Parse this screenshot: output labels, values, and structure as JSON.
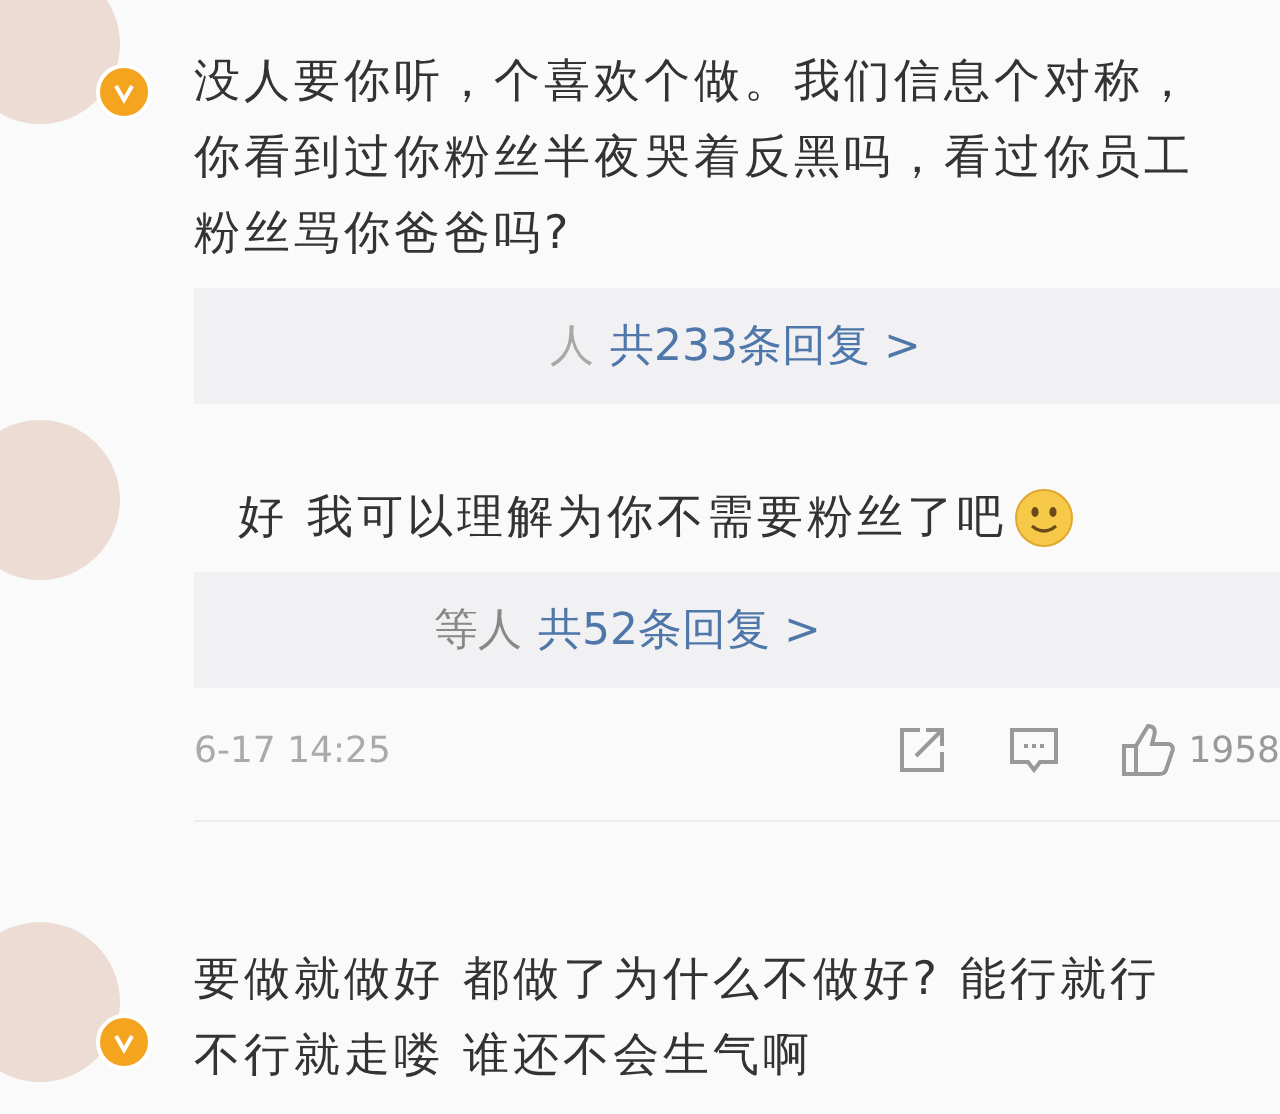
{
  "comments": [
    {
      "lines": [
        "没人要你听，个喜欢个做。我们信息个对称，",
        "你看到过你粉丝半夜哭着反黑吗，看过你员工",
        "粉丝骂你爸爸吗?"
      ],
      "verified": true,
      "replies": {
        "names": "人",
        "count": "共233条回复 >"
      }
    },
    {
      "lines": [
        "好 我可以理解为你不需要粉丝了吧"
      ],
      "emoji": true,
      "verified": false,
      "replies": {
        "names": "等人",
        "count": "共52条回复 >"
      },
      "time": "6-17 14:25",
      "likes": "1958"
    },
    {
      "lines": [
        "要做就做好 都做了为什么不做好? 能行就行",
        "不行就走喽 谁还不会生气啊"
      ],
      "verified": true
    }
  ]
}
